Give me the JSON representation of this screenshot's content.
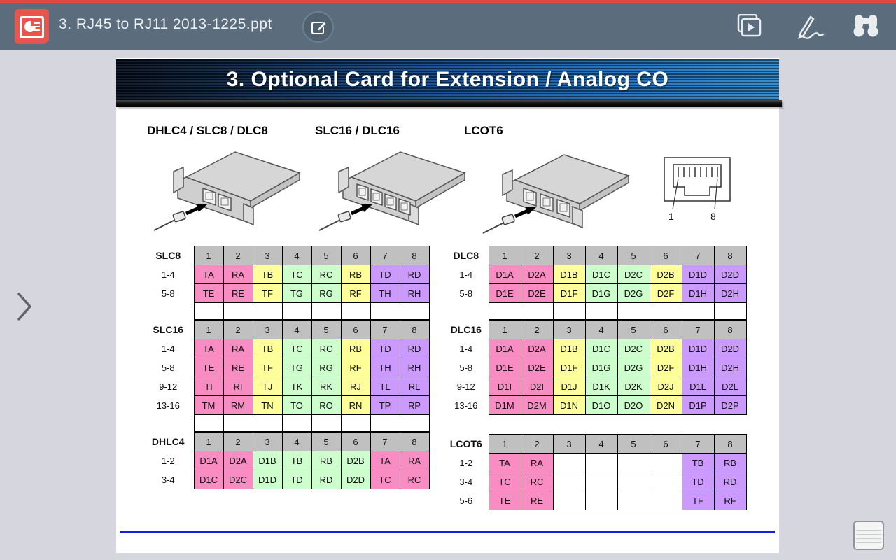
{
  "app": {
    "document_title": "3. RJ45 to RJ11 2013-1225.ppt",
    "toolbar_icons": [
      "presentation-file-icon",
      "edit-icon",
      "slideshow-play-icon",
      "pen-annotate-icon",
      "binoculars-find-icon"
    ],
    "nav": {
      "next_arrow": "chevron-right",
      "notes_button": "notes-panel"
    }
  },
  "slide": {
    "title": "3. Optional Card for Extension / Analog CO",
    "card_labels": [
      "DHLC4 / SLC8 / DLC8",
      "SLC16 / DLC16",
      "LCOT6"
    ],
    "rj45": {
      "pin_first": "1",
      "pin_last": "8"
    }
  },
  "colors": {
    "pink": "#F98CC2",
    "yellow": "#FFFF99",
    "green": "#CCFFCC",
    "purple": "#CC99FF",
    "header_gray": "#C0C0C0",
    "white": "#FFFFFF",
    "blue_rule": "#1A1AD8"
  },
  "table_groups": [
    {
      "side": "left",
      "tables": [
        {
          "name": "SLC8",
          "columns": [
            "1",
            "2",
            "3",
            "4",
            "5",
            "6",
            "7",
            "8"
          ],
          "rows": [
            {
              "label": "1-4",
              "cells": [
                [
                  "TA",
                  "pink"
                ],
                [
                  "RA",
                  "pink"
                ],
                [
                  "TB",
                  "yellow"
                ],
                [
                  "TC",
                  "green"
                ],
                [
                  "RC",
                  "green"
                ],
                [
                  "RB",
                  "yellow"
                ],
                [
                  "TD",
                  "purple"
                ],
                [
                  "RD",
                  "purple"
                ]
              ]
            },
            {
              "label": "5-8",
              "cells": [
                [
                  "TE",
                  "pink"
                ],
                [
                  "RE",
                  "pink"
                ],
                [
                  "TF",
                  "yellow"
                ],
                [
                  "TG",
                  "green"
                ],
                [
                  "RG",
                  "green"
                ],
                [
                  "RF",
                  "yellow"
                ],
                [
                  "TH",
                  "purple"
                ],
                [
                  "RH",
                  "purple"
                ]
              ]
            }
          ],
          "trailing_empty": true,
          "gap_before": 0
        },
        {
          "name": "SLC16",
          "columns": [
            "1",
            "2",
            "3",
            "4",
            "5",
            "6",
            "7",
            "8"
          ],
          "rows": [
            {
              "label": "1-4",
              "cells": [
                [
                  "TA",
                  "pink"
                ],
                [
                  "RA",
                  "pink"
                ],
                [
                  "TB",
                  "yellow"
                ],
                [
                  "TC",
                  "green"
                ],
                [
                  "RC",
                  "green"
                ],
                [
                  "RB",
                  "yellow"
                ],
                [
                  "TD",
                  "purple"
                ],
                [
                  "RD",
                  "purple"
                ]
              ]
            },
            {
              "label": "5-8",
              "cells": [
                [
                  "TE",
                  "pink"
                ],
                [
                  "RE",
                  "pink"
                ],
                [
                  "TF",
                  "yellow"
                ],
                [
                  "TG",
                  "green"
                ],
                [
                  "RG",
                  "green"
                ],
                [
                  "RF",
                  "yellow"
                ],
                [
                  "TH",
                  "purple"
                ],
                [
                  "RH",
                  "purple"
                ]
              ]
            },
            {
              "label": "9-12",
              "cells": [
                [
                  "TI",
                  "pink"
                ],
                [
                  "RI",
                  "pink"
                ],
                [
                  "TJ",
                  "yellow"
                ],
                [
                  "TK",
                  "green"
                ],
                [
                  "RK",
                  "green"
                ],
                [
                  "RJ",
                  "yellow"
                ],
                [
                  "TL",
                  "purple"
                ],
                [
                  "RL",
                  "purple"
                ]
              ]
            },
            {
              "label": "13-16",
              "cells": [
                [
                  "TM",
                  "pink"
                ],
                [
                  "RM",
                  "pink"
                ],
                [
                  "TN",
                  "yellow"
                ],
                [
                  "TO",
                  "green"
                ],
                [
                  "RO",
                  "green"
                ],
                [
                  "RN",
                  "yellow"
                ],
                [
                  "TP",
                  "purple"
                ],
                [
                  "RP",
                  "purple"
                ]
              ]
            }
          ],
          "trailing_empty": true,
          "gap_before": 0
        },
        {
          "name": "DHLC4",
          "columns": [
            "1",
            "2",
            "3",
            "4",
            "5",
            "6",
            "7",
            "8"
          ],
          "rows": [
            {
              "label": "1-2",
              "cells": [
                [
                  "D1A",
                  "pink"
                ],
                [
                  "D2A",
                  "pink"
                ],
                [
                  "D1B",
                  "green"
                ],
                [
                  "TB",
                  "green"
                ],
                [
                  "RB",
                  "green"
                ],
                [
                  "D2B",
                  "green"
                ],
                [
                  "TA",
                  "pink"
                ],
                [
                  "RA",
                  "pink"
                ]
              ]
            },
            {
              "label": "3-4",
              "cells": [
                [
                  "D1C",
                  "pink"
                ],
                [
                  "D2C",
                  "pink"
                ],
                [
                  "D1D",
                  "green"
                ],
                [
                  "TD",
                  "green"
                ],
                [
                  "RD",
                  "green"
                ],
                [
                  "D2D",
                  "green"
                ],
                [
                  "TC",
                  "pink"
                ],
                [
                  "RC",
                  "pink"
                ]
              ]
            }
          ],
          "trailing_empty": false,
          "gap_before": 0
        }
      ]
    },
    {
      "side": "right",
      "tables": [
        {
          "name": "DLC8",
          "columns": [
            "1",
            "2",
            "3",
            "4",
            "5",
            "6",
            "7",
            "8"
          ],
          "rows": [
            {
              "label": "1-4",
              "cells": [
                [
                  "D1A",
                  "pink"
                ],
                [
                  "D2A",
                  "pink"
                ],
                [
                  "D1B",
                  "yellow"
                ],
                [
                  "D1C",
                  "green"
                ],
                [
                  "D2C",
                  "green"
                ],
                [
                  "D2B",
                  "yellow"
                ],
                [
                  "D1D",
                  "purple"
                ],
                [
                  "D2D",
                  "purple"
                ]
              ]
            },
            {
              "label": "5-8",
              "cells": [
                [
                  "D1E",
                  "pink"
                ],
                [
                  "D2E",
                  "pink"
                ],
                [
                  "D1F",
                  "yellow"
                ],
                [
                  "D1G",
                  "green"
                ],
                [
                  "D2G",
                  "green"
                ],
                [
                  "D2F",
                  "yellow"
                ],
                [
                  "D1H",
                  "purple"
                ],
                [
                  "D2H",
                  "purple"
                ]
              ]
            }
          ],
          "trailing_empty": true,
          "gap_before": 0
        },
        {
          "name": "DLC16",
          "columns": [
            "1",
            "2",
            "3",
            "4",
            "5",
            "6",
            "7",
            "8"
          ],
          "rows": [
            {
              "label": "1-4",
              "cells": [
                [
                  "D1A",
                  "pink"
                ],
                [
                  "D2A",
                  "pink"
                ],
                [
                  "D1B",
                  "yellow"
                ],
                [
                  "D1C",
                  "green"
                ],
                [
                  "D2C",
                  "green"
                ],
                [
                  "D2B",
                  "yellow"
                ],
                [
                  "D1D",
                  "purple"
                ],
                [
                  "D2D",
                  "purple"
                ]
              ]
            },
            {
              "label": "5-8",
              "cells": [
                [
                  "D1E",
                  "pink"
                ],
                [
                  "D2E",
                  "pink"
                ],
                [
                  "D1F",
                  "yellow"
                ],
                [
                  "D1G",
                  "green"
                ],
                [
                  "D2G",
                  "green"
                ],
                [
                  "D2F",
                  "yellow"
                ],
                [
                  "D1H",
                  "purple"
                ],
                [
                  "D2H",
                  "purple"
                ]
              ]
            },
            {
              "label": "9-12",
              "cells": [
                [
                  "D1I",
                  "pink"
                ],
                [
                  "D2I",
                  "pink"
                ],
                [
                  "D1J",
                  "yellow"
                ],
                [
                  "D1K",
                  "green"
                ],
                [
                  "D2K",
                  "green"
                ],
                [
                  "D2J",
                  "yellow"
                ],
                [
                  "D1L",
                  "purple"
                ],
                [
                  "D2L",
                  "purple"
                ]
              ]
            },
            {
              "label": "13-16",
              "cells": [
                [
                  "D1M",
                  "pink"
                ],
                [
                  "D2M",
                  "pink"
                ],
                [
                  "D1N",
                  "yellow"
                ],
                [
                  "D1O",
                  "green"
                ],
                [
                  "D2O",
                  "green"
                ],
                [
                  "D2N",
                  "yellow"
                ],
                [
                  "D1P",
                  "purple"
                ],
                [
                  "D2P",
                  "purple"
                ]
              ]
            }
          ],
          "trailing_empty": false,
          "gap_before": 0
        },
        {
          "name": "LCOT6",
          "columns": [
            "1",
            "2",
            "3",
            "4",
            "5",
            "6",
            "7",
            "8"
          ],
          "rows": [
            {
              "label": "1-2",
              "cells": [
                [
                  "TA",
                  "pink"
                ],
                [
                  "RA",
                  "pink"
                ],
                [
                  "",
                  "white"
                ],
                [
                  "",
                  "white"
                ],
                [
                  "",
                  "white"
                ],
                [
                  "",
                  "white"
                ],
                [
                  "TB",
                  "purple"
                ],
                [
                  "RB",
                  "purple"
                ]
              ]
            },
            {
              "label": "3-4",
              "cells": [
                [
                  "TC",
                  "pink"
                ],
                [
                  "RC",
                  "pink"
                ],
                [
                  "",
                  "white"
                ],
                [
                  "",
                  "white"
                ],
                [
                  "",
                  "white"
                ],
                [
                  "",
                  "white"
                ],
                [
                  "TD",
                  "purple"
                ],
                [
                  "RD",
                  "purple"
                ]
              ]
            },
            {
              "label": "5-6",
              "cells": [
                [
                  "TE",
                  "pink"
                ],
                [
                  "RE",
                  "pink"
                ],
                [
                  "",
                  "white"
                ],
                [
                  "",
                  "white"
                ],
                [
                  "",
                  "white"
                ],
                [
                  "",
                  "white"
                ],
                [
                  "TF",
                  "purple"
                ],
                [
                  "RF",
                  "purple"
                ]
              ]
            }
          ],
          "trailing_empty": false,
          "gap_before": 27
        }
      ]
    }
  ]
}
